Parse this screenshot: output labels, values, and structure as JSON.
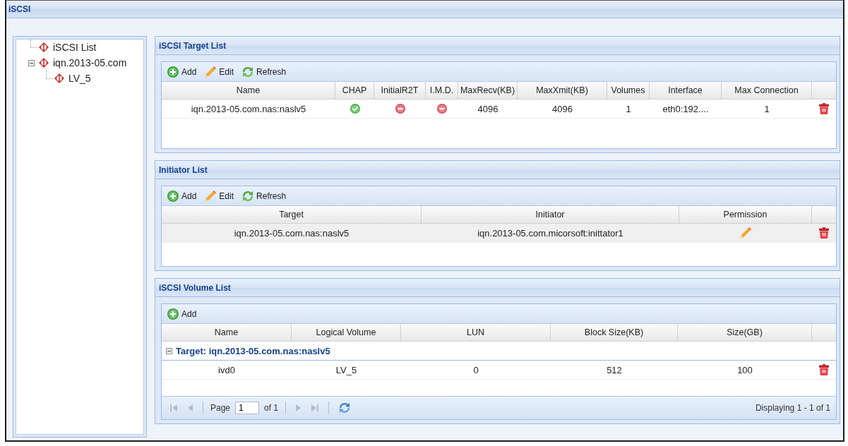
{
  "window": {
    "title": "iSCSI"
  },
  "tree": {
    "items": [
      {
        "label": "iSCSI List"
      },
      {
        "label": "iqn.2013-05.com",
        "expanded": true,
        "children": [
          {
            "label": "LV_5"
          }
        ]
      }
    ]
  },
  "panels": [
    {
      "title": "iSCSI Target List",
      "toolbar": [
        {
          "kind": "add",
          "label": "Add"
        },
        {
          "kind": "edit",
          "label": "Edit"
        },
        {
          "kind": "refresh",
          "label": "Refresh"
        }
      ],
      "table": {
        "columns": [
          "Name",
          "CHAP",
          "InitialR2T",
          "I.M.D.",
          "MaxRecv(KB)",
          "MaxXmit(KB)",
          "Volumes",
          "Interface",
          "Max Connection"
        ],
        "rows": [
          {
            "highlighted": false,
            "cells": [
              {
                "kind": "text",
                "text": "iqn.2013-05.com.nas:naslv5"
              },
              {
                "kind": "flag",
                "on": true
              },
              {
                "kind": "flag",
                "on": false
              },
              {
                "kind": "flag",
                "on": false
              },
              {
                "kind": "text",
                "text": "4096"
              },
              {
                "kind": "text",
                "text": "4096"
              },
              {
                "kind": "text",
                "text": "1"
              },
              {
                "kind": "text",
                "text": "eth0:192...."
              },
              {
                "kind": "text",
                "text": "1"
              }
            ]
          }
        ]
      }
    },
    {
      "title": "Initiator List",
      "toolbar": [
        {
          "kind": "add",
          "label": "Add"
        },
        {
          "kind": "edit",
          "label": "Edit"
        },
        {
          "kind": "refresh",
          "label": "Refresh"
        }
      ],
      "table": {
        "columns": [
          "Target",
          "Initiator",
          "Permission"
        ],
        "rows": [
          {
            "highlighted": true,
            "cells": [
              {
                "kind": "text",
                "text": "iqn.2013-05.com.nas:naslv5"
              },
              {
                "kind": "text",
                "text": "iqn.2013-05.com.micorsoft:inittator1"
              },
              {
                "kind": "edit"
              }
            ]
          }
        ]
      }
    },
    {
      "title": "iSCSI Volume List",
      "toolbar": [
        {
          "kind": "add",
          "label": "Add"
        }
      ],
      "table": {
        "columns": [
          "Name",
          "Logical Volume",
          "LUN",
          "Block Size(KB)",
          "Size(GB)"
        ],
        "groups": [
          {
            "label": "Target: iqn.2013-05.com.nas:naslv5",
            "expanded": true,
            "rows": [
              {
                "highlighted": false,
                "cells": [
                  {
                    "kind": "text",
                    "text": "ivd0"
                  },
                  {
                    "kind": "text",
                    "text": "LV_5"
                  },
                  {
                    "kind": "text",
                    "text": "0"
                  },
                  {
                    "kind": "text",
                    "text": "512"
                  },
                  {
                    "kind": "text",
                    "text": "100"
                  }
                ]
              }
            ]
          }
        ]
      },
      "paging": {
        "nav_back": [
          {
            "kind": "first",
            "disabled": true
          },
          {
            "kind": "prev",
            "disabled": true
          }
        ],
        "page_label": "Page",
        "page_value": "1",
        "page_total": "of 1",
        "nav_forward": [
          {
            "kind": "next",
            "disabled": true
          },
          {
            "kind": "last",
            "disabled": true
          }
        ],
        "summary": "Displaying 1 - 1 of 1"
      }
    }
  ]
}
